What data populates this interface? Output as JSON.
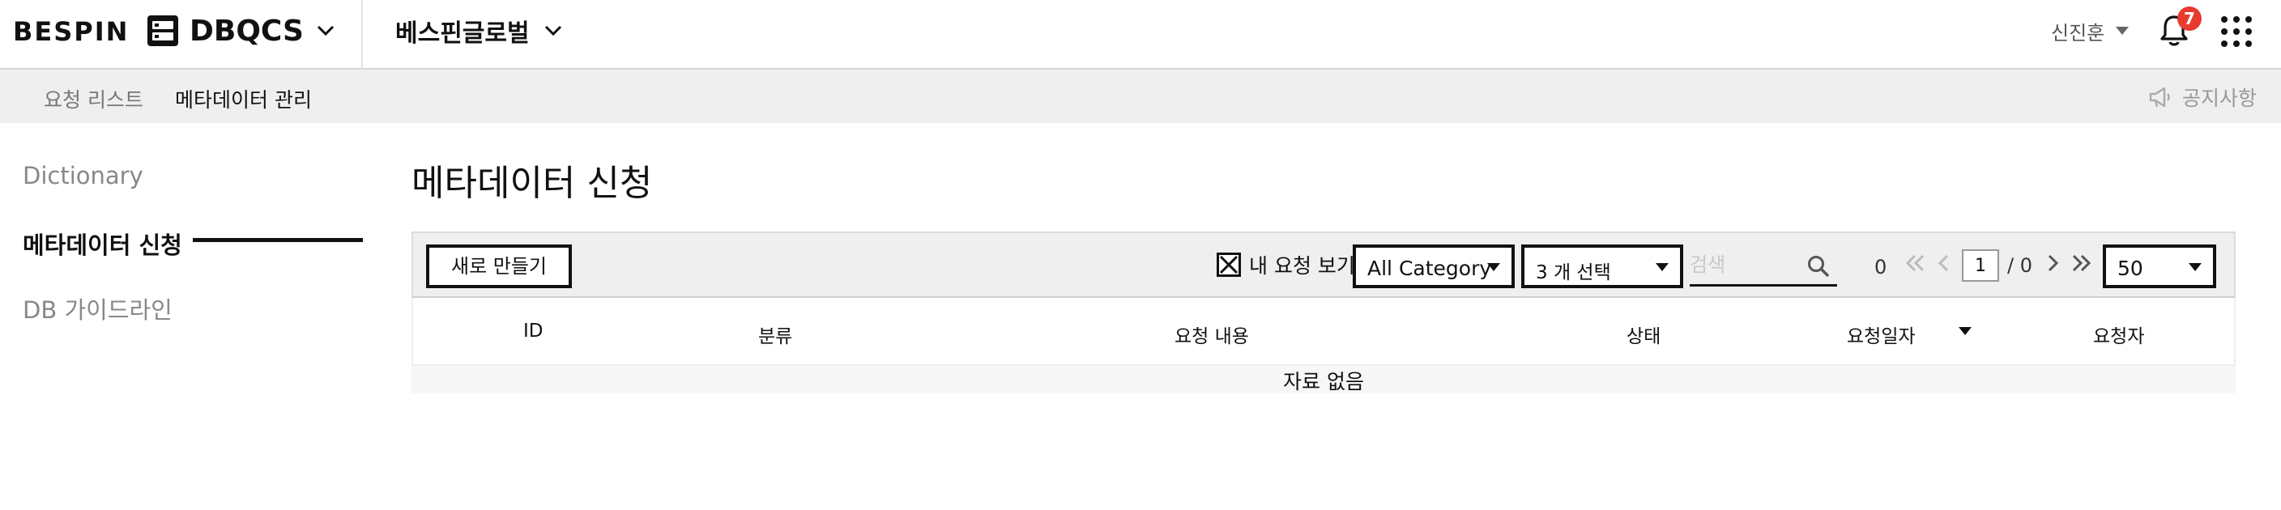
{
  "header": {
    "logo_text": "BESPIN",
    "app_name": "DBQCS",
    "org_name": "베스핀글로벌",
    "user_name": "신진훈",
    "notification_count": "7"
  },
  "subnav": {
    "tabs": [
      {
        "label": "요청 리스트"
      },
      {
        "label": "메타데이터 관리"
      }
    ],
    "notice_label": "공지사항"
  },
  "sidebar": {
    "items": [
      {
        "label": "Dictionary"
      },
      {
        "label": "메타데이터 신청",
        "active": true
      },
      {
        "label": "DB 가이드라인"
      }
    ]
  },
  "main": {
    "title": "메타데이터 신청",
    "toolbar": {
      "new_button": "새로 만들기",
      "my_requests_label": "내 요청 보기",
      "my_requests_checked": true,
      "category_select": "All Category",
      "multi_select": "3 개 선택",
      "search_placeholder": "검색",
      "total_count": "0",
      "current_page": "1",
      "total_pages": "/ 0",
      "page_size": "50"
    },
    "table": {
      "columns": [
        "ID",
        "분류",
        "요청 내용",
        "상태",
        "요청일자",
        "요청자"
      ],
      "empty_text": "자료 없음"
    }
  },
  "colors": {
    "badge": "#e63b2e",
    "subnav_bg": "#efefef",
    "text_primary": "#111111",
    "text_muted": "#888888"
  }
}
